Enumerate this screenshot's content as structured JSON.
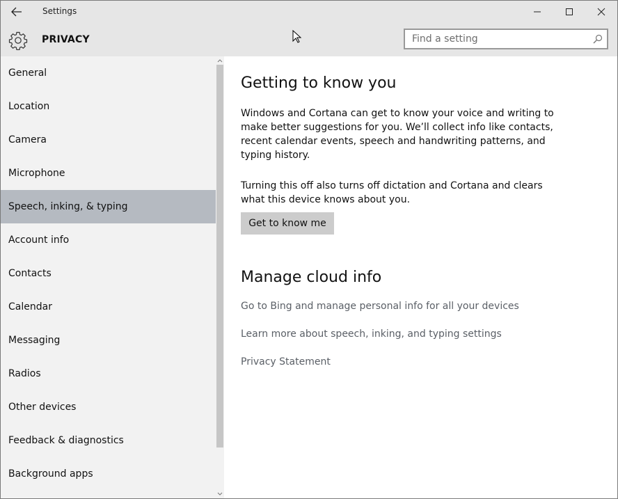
{
  "window": {
    "title": "Settings"
  },
  "header": {
    "title": "PRIVACY",
    "search_placeholder": "Find a setting"
  },
  "sidebar": {
    "selected_index": 4,
    "items": [
      {
        "label": "General"
      },
      {
        "label": "Location"
      },
      {
        "label": "Camera"
      },
      {
        "label": "Microphone"
      },
      {
        "label": "Speech, inking, & typing"
      },
      {
        "label": "Account info"
      },
      {
        "label": "Contacts"
      },
      {
        "label": "Calendar"
      },
      {
        "label": "Messaging"
      },
      {
        "label": "Radios"
      },
      {
        "label": "Other devices"
      },
      {
        "label": "Feedback & diagnostics"
      },
      {
        "label": "Background apps"
      }
    ]
  },
  "main": {
    "section1": {
      "heading": "Getting to know you",
      "para1": "Windows and Cortana can get to know your voice and writing to make better suggestions for you. We’ll collect info like contacts, recent calendar events, speech and handwriting patterns, and typing history.",
      "para2": "Turning this off also turns off dictation and Cortana and clears what this device knows about you.",
      "button_label": "Get to know me"
    },
    "section2": {
      "heading": "Manage cloud info",
      "links": [
        "Go to Bing and manage personal info for all your devices",
        "Learn more about speech, inking, and typing settings",
        "Privacy Statement"
      ]
    }
  },
  "colors": {
    "titlebar_bg": "#e6e6e6",
    "sidebar_bg": "#f2f2f2",
    "selected_bg": "#b5bac1",
    "button_bg": "#cccccc",
    "link_color": "#5a5f66"
  }
}
